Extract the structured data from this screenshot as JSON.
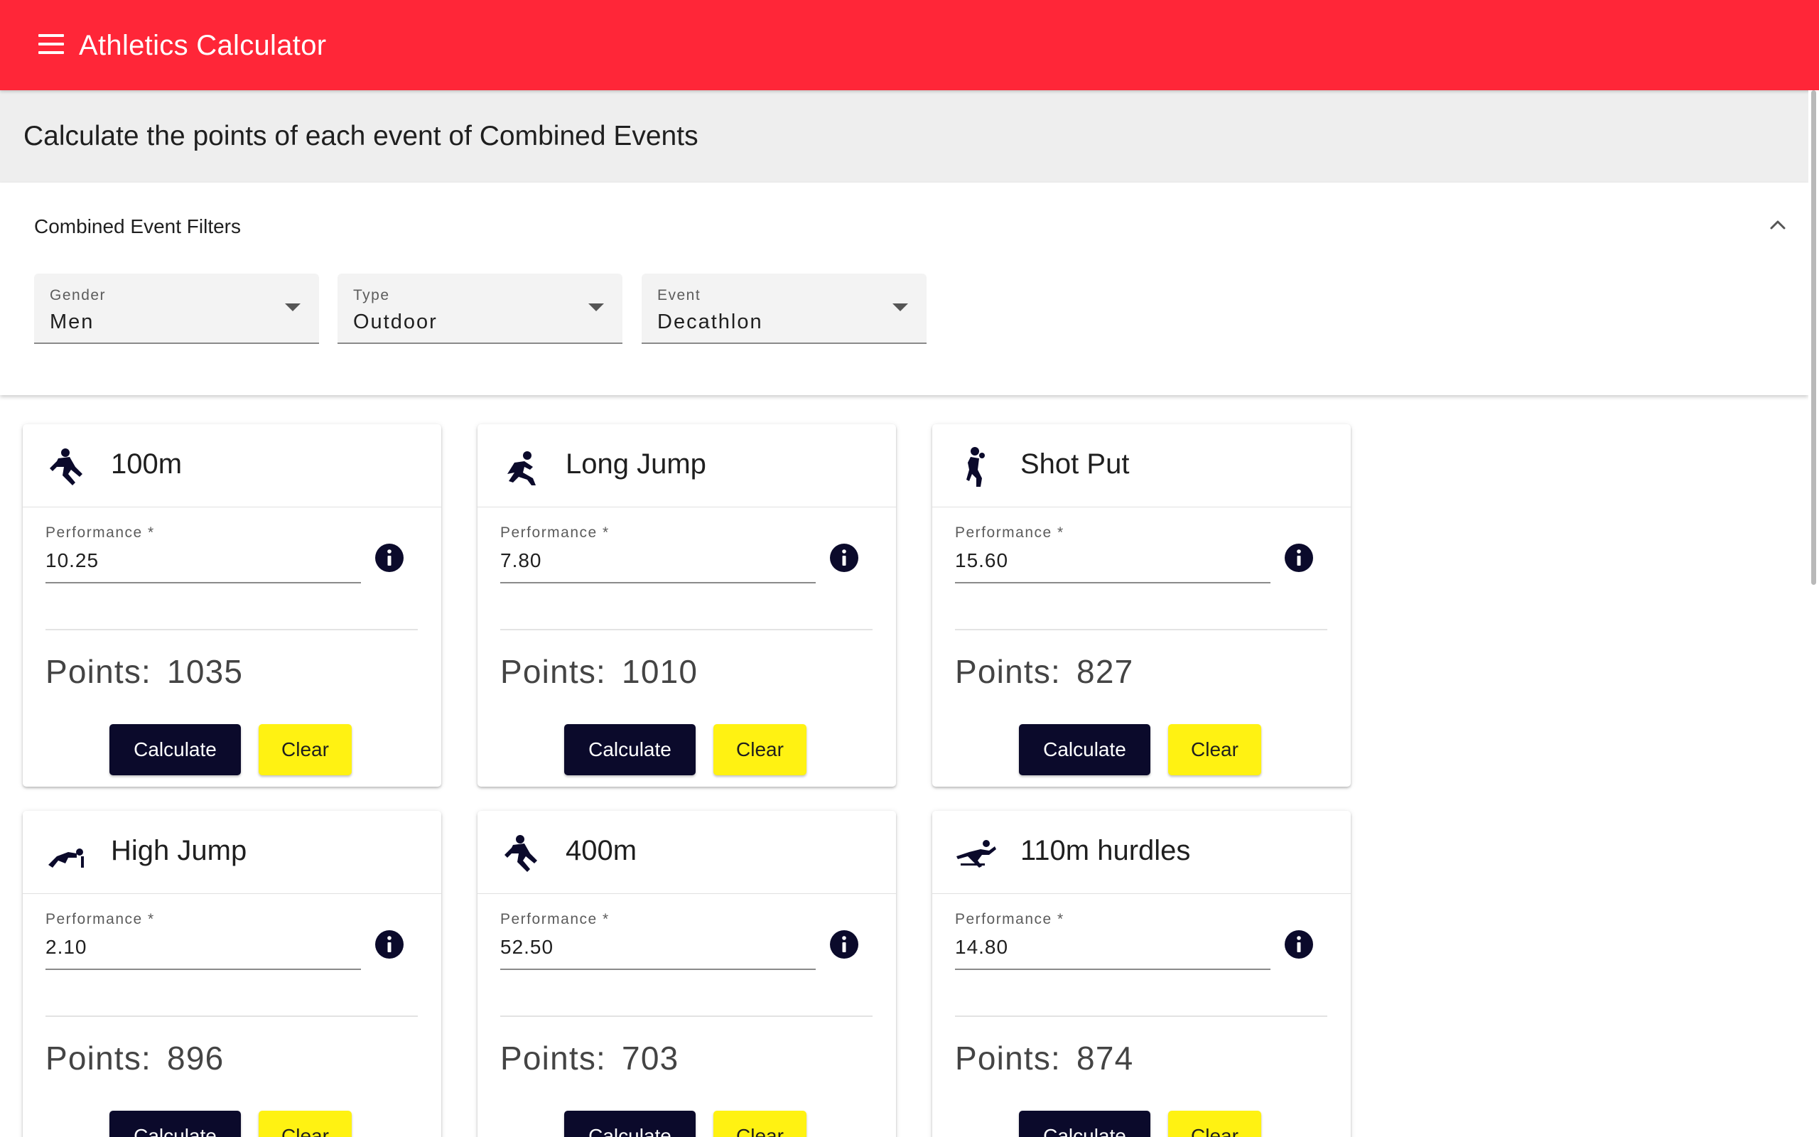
{
  "app": {
    "title": "Athletics Calculator"
  },
  "page": {
    "title": "Calculate the points of each event of Combined Events"
  },
  "filters": {
    "title": "Combined Event Filters",
    "gender": {
      "label": "Gender",
      "value": "Men"
    },
    "type": {
      "label": "Type",
      "value": "Outdoor"
    },
    "event": {
      "label": "Event",
      "value": "Decathlon"
    }
  },
  "field_label": "Performance *",
  "points_label": "Points:",
  "calculate_label": "Calculate",
  "clear_label": "Clear",
  "colors": {
    "appbar": "#ff2638",
    "primary_dark": "#0b0a2b",
    "accent_yellow": "#fff212"
  },
  "cards": [
    {
      "title": "100m",
      "icon": "sprinter-icon",
      "performance": "10.25",
      "points": "1035"
    },
    {
      "title": "Long Jump",
      "icon": "long-jumper-icon",
      "performance": "7.80",
      "points": "1010"
    },
    {
      "title": "Shot Put",
      "icon": "shot-putter-icon",
      "performance": "15.60",
      "points": "827"
    },
    {
      "title": "High Jump",
      "icon": "high-jumper-icon",
      "performance": "2.10",
      "points": "896"
    },
    {
      "title": "400m",
      "icon": "runner-icon",
      "performance": "52.50",
      "points": "703"
    },
    {
      "title": "110m hurdles",
      "icon": "hurdler-icon",
      "performance": "14.80",
      "points": "874"
    }
  ]
}
